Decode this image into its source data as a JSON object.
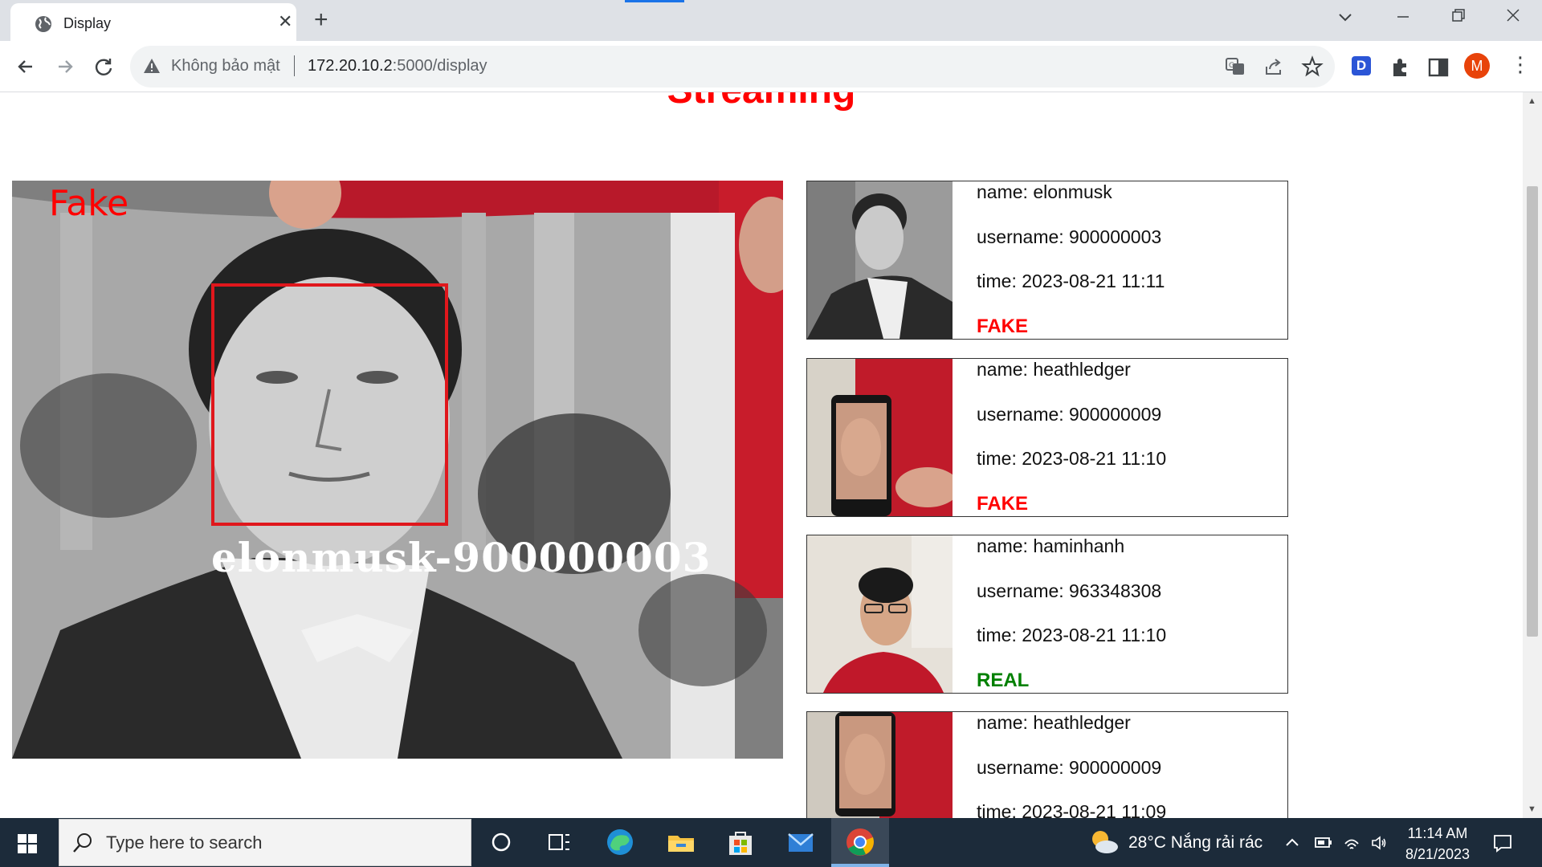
{
  "browser": {
    "tab_title": "Display",
    "omnibox": {
      "security_text": "Không bảo mật",
      "host": "172.20.10.2",
      "path": ":5000/display"
    },
    "profile_initial": "M",
    "extension_letter": "D"
  },
  "page": {
    "heading": "Streaming",
    "stream": {
      "detection_label": "Fake",
      "detection_identity": "elonmusk-900000003"
    },
    "history": [
      {
        "name": "name: elonmusk",
        "username": "username: 900000003",
        "time": "time: 2023-08-21 11:11",
        "status": "FAKE",
        "status_color": "#ff0000"
      },
      {
        "name": "name: heathledger",
        "username": "username: 900000009",
        "time": "time: 2023-08-21 11:10",
        "status": "FAKE",
        "status_color": "#ff0000"
      },
      {
        "name": "name: haminhanh",
        "username": "username: 963348308",
        "time": "time: 2023-08-21 11:10",
        "status": "REAL",
        "status_color": "#008000"
      },
      {
        "name": "name: heathledger",
        "username": "username: 900000009",
        "time": "time: 2023-08-21 11:09",
        "status": "",
        "status_color": "#ff0000"
      }
    ]
  },
  "taskbar": {
    "search_placeholder": "Type here to search",
    "weather": "28°C  Nắng rải rác",
    "time": "11:14 AM",
    "date": "8/21/2023"
  },
  "colors": {
    "heading": "#ff0000",
    "fake": "#ff0000",
    "real": "#008000",
    "taskbar": "#1c2b3a"
  }
}
